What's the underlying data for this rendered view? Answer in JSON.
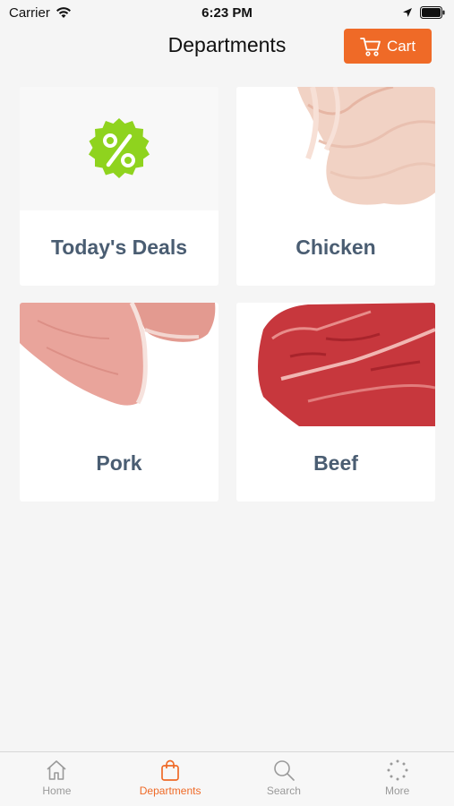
{
  "status_bar": {
    "carrier": "Carrier",
    "time": "6:23 PM"
  },
  "header": {
    "title": "Departments",
    "cart_label": "Cart"
  },
  "departments": [
    {
      "label": "Today's Deals",
      "icon": "percent-badge-icon"
    },
    {
      "label": "Chicken",
      "icon": "chicken-image"
    },
    {
      "label": "Pork",
      "icon": "pork-image"
    },
    {
      "label": "Beef",
      "icon": "beef-image"
    }
  ],
  "tabs": [
    {
      "label": "Home",
      "icon": "home-icon",
      "active": false
    },
    {
      "label": "Departments",
      "icon": "bag-icon",
      "active": true
    },
    {
      "label": "Search",
      "icon": "search-icon",
      "active": false
    },
    {
      "label": "More",
      "icon": "more-icon",
      "active": false
    }
  ],
  "colors": {
    "accent": "#ef6a27",
    "card_text": "#4a5d72",
    "deal_badge": "#8fd31e"
  }
}
